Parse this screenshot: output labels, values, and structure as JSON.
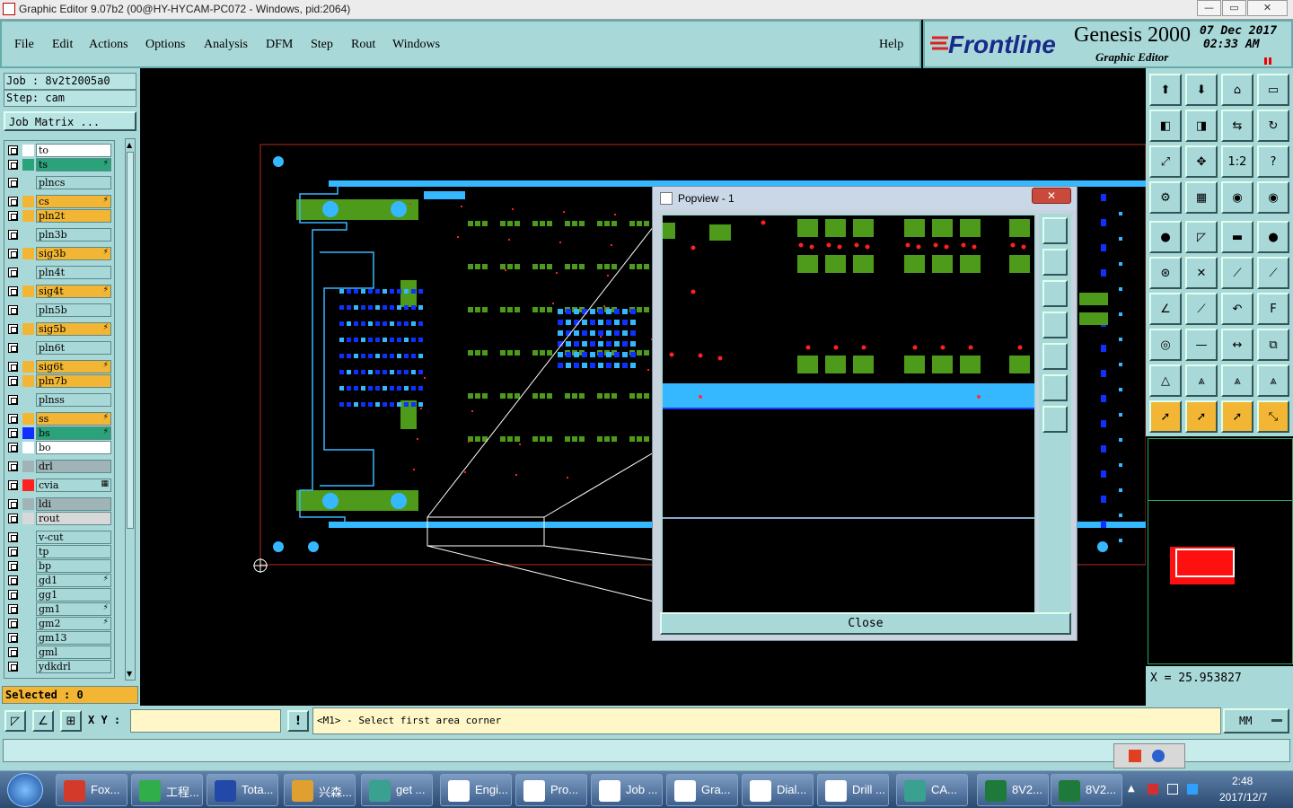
{
  "window": {
    "title": "Graphic Editor 9.07b2 (00@HY-HYCAM-PC072 - Windows, pid:2064)",
    "icon": "x-close-icon",
    "min": "—",
    "max": "▭",
    "close": "✕"
  },
  "menu": [
    "File",
    "Edit",
    "Actions",
    "Options",
    "Analysis",
    "DFM",
    "Step",
    "Rout",
    "Windows"
  ],
  "help": "Help",
  "brand": {
    "logo": "Frontline",
    "product": "Genesis 2000",
    "subtitle": "Graphic Editor",
    "date": "07 Dec 2017",
    "time": "02:33 AM"
  },
  "job": {
    "job_label": "Job : 8v2t2005a0",
    "step_label": "Step: cam",
    "matrix_button": "Job Matrix ..."
  },
  "layers": [
    {
      "name": "to",
      "color": "#ffffff",
      "swatch": "#ffffff"
    },
    {
      "name": "ts",
      "color": "#2aa37a",
      "swatch": "#2aa37a",
      "pen": "⚡"
    },
    {
      "name": "plncs",
      "color": "#a9d8d8",
      "swatch": "#a9d8d8"
    },
    {
      "name": "cs",
      "color": "#f2b634",
      "swatch": "#f2b634",
      "pen": "⚡"
    },
    {
      "name": "pln2t",
      "color": "#f2b634",
      "swatch": "#f2b634"
    },
    {
      "name": "pln3b",
      "color": "#a9d8d8",
      "swatch": "#a9d8d8"
    },
    {
      "name": "sig3b",
      "color": "#f2b634",
      "swatch": "#f2b634",
      "pen": "⚡"
    },
    {
      "name": "pln4t",
      "color": "#a9d8d8",
      "swatch": "#a9d8d8"
    },
    {
      "name": "sig4t",
      "color": "#f2b634",
      "swatch": "#f2b634",
      "pen": "⚡"
    },
    {
      "name": "pln5b",
      "color": "#a9d8d8",
      "swatch": "#a9d8d8"
    },
    {
      "name": "sig5b",
      "color": "#f2b634",
      "swatch": "#f2b634",
      "pen": "⚡"
    },
    {
      "name": "pln6t",
      "color": "#a9d8d8",
      "swatch": "#a9d8d8"
    },
    {
      "name": "sig6t",
      "color": "#f2b634",
      "swatch": "#f2b634",
      "pen": "⚡"
    },
    {
      "name": "pln7b",
      "color": "#f2b634",
      "swatch": "#f2b634"
    },
    {
      "name": "plnss",
      "color": "#a9d8d8",
      "swatch": "#a9d8d8"
    },
    {
      "name": "ss",
      "color": "#f2b634",
      "swatch": "#f2b634",
      "pen": "⚡"
    },
    {
      "name": "bs",
      "color": "#2aa37a",
      "swatch": "#1030ff",
      "pen": "⚡"
    },
    {
      "name": "bo",
      "color": "#ffffff",
      "swatch": "#ffffff"
    },
    {
      "name": "drl",
      "color": "#a0b4b8",
      "swatch": "#a0b4b8"
    },
    {
      "name": "cvia",
      "color": "#a9d8d8",
      "swatch": "#ff2020",
      "pen": "▦"
    },
    {
      "name": "ldi",
      "color": "#a0b4b8",
      "swatch": "#a0b4b8"
    },
    {
      "name": "rout",
      "color": "#d8d8d8",
      "swatch": "#d8d8d8"
    },
    {
      "name": "v-cut",
      "color": "#a9d8d8",
      "swatch": "#a9d8d8"
    },
    {
      "name": "tp",
      "color": "#a9d8d8",
      "swatch": "#a9d8d8"
    },
    {
      "name": "bp",
      "color": "#a9d8d8",
      "swatch": "#a9d8d8"
    },
    {
      "name": "gd1",
      "color": "#a9d8d8",
      "swatch": "#a9d8d8",
      "pen": "⚡"
    },
    {
      "name": "gg1",
      "color": "#a9d8d8",
      "swatch": "#a9d8d8"
    },
    {
      "name": "gm1",
      "color": "#a9d8d8",
      "swatch": "#a9d8d8",
      "pen": "⚡"
    },
    {
      "name": "gm2",
      "color": "#a9d8d8",
      "swatch": "#a9d8d8",
      "pen": "⚡"
    },
    {
      "name": "gm13",
      "color": "#a9d8d8",
      "swatch": "#a9d8d8"
    },
    {
      "name": "gml",
      "color": "#a9d8d8",
      "swatch": "#a9d8d8"
    },
    {
      "name": "ydkdrl",
      "color": "#a9d8d8",
      "swatch": "#a9d8d8"
    }
  ],
  "selected": "Selected : 0",
  "status": {
    "xy_label": "X Y :",
    "xy_value": "",
    "warn": "!",
    "prompt": "<M1> - Select first area corner",
    "units": "MM"
  },
  "coord": "X = 25.953827",
  "popview": {
    "title": "Popview - 1",
    "close_x": "✕",
    "close_button": "Close"
  },
  "taskbar": {
    "items": [
      {
        "label": "Fox...",
        "icon": "foxit-icon",
        "color": "#d43a2a"
      },
      {
        "label": "工程...",
        "icon": "p-app-icon",
        "color": "#2fae4a"
      },
      {
        "label": "Tota...",
        "icon": "floppy-icon",
        "color": "#2248a8"
      },
      {
        "label": "兴森...",
        "icon": "shell-icon",
        "color": "#e0a030"
      },
      {
        "label": "get ...",
        "icon": "eye-icon",
        "color": "#3aa090"
      },
      {
        "label": "Engi...",
        "icon": "x-app-icon",
        "color": "#ffffff"
      },
      {
        "label": "Pro...",
        "icon": "x-app-icon",
        "color": "#ffffff"
      },
      {
        "label": "Job ...",
        "icon": "x-app-icon",
        "color": "#ffffff"
      },
      {
        "label": "Gra...",
        "icon": "x-app-icon",
        "color": "#ffffff"
      },
      {
        "label": "Dial...",
        "icon": "x-app-icon",
        "color": "#ffffff"
      },
      {
        "label": "Drill ...",
        "icon": "x-app-icon",
        "color": "#ffffff"
      },
      {
        "label": "CA...",
        "icon": "cam-icon",
        "color": "#3aa090"
      },
      {
        "label": "8V2...",
        "icon": "excel-icon",
        "color": "#1e7a3a"
      },
      {
        "label": "8V2...",
        "icon": "excel-icon",
        "color": "#1e7a3a"
      }
    ],
    "time": "2:48",
    "date": "2017/12/7"
  }
}
